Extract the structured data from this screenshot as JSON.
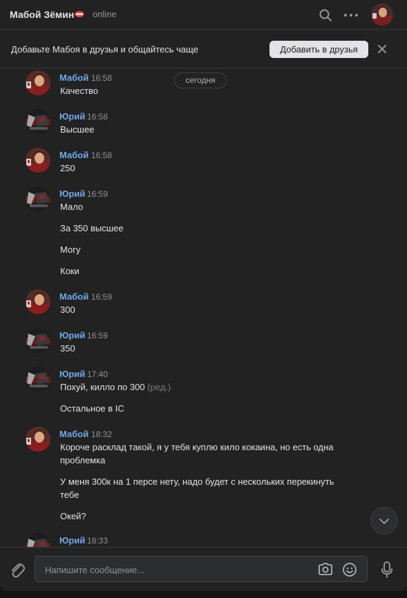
{
  "header": {
    "title": "Мабой Зёмин",
    "status": "online",
    "search_icon": "search-icon",
    "more_icon": "more-horizontal-icon"
  },
  "friend_bar": {
    "text": "Добавьте Мабоя в друзья и общайтесь чаще",
    "button": "Добавить в друзья"
  },
  "date_separator": "сегодня",
  "messages": [
    {
      "author": "Мабой",
      "time": "16:58",
      "lines": [
        "Качество"
      ]
    },
    {
      "author": "Юрий",
      "time": "16:58",
      "lines": [
        "Высшее"
      ]
    },
    {
      "author": "Мабой",
      "time": "16:58",
      "lines": [
        "250"
      ]
    },
    {
      "author": "Юрий",
      "time": "16:59",
      "lines": [
        "Мало",
        "За 350 высшее",
        "Могу",
        "Коки"
      ]
    },
    {
      "author": "Мабой",
      "time": "16:59",
      "lines": [
        "300"
      ]
    },
    {
      "author": "Юрий",
      "time": "16:59",
      "lines": [
        "350"
      ]
    },
    {
      "author": "Юрий",
      "time": "17:40",
      "lines": [
        "Похуй, килло по 300",
        "Остальное в IC"
      ],
      "edited": "(ред.)"
    },
    {
      "author": "Мабой",
      "time": "18:32",
      "lines": [
        "Короче расклад такой, я у тебя куплю кило кокаина, но есть одна проблемка",
        "У меня 300к на 1 персе нету, надо будет с нескольких перекинуть тебе",
        "Окей?"
      ]
    },
    {
      "author": "Юрий",
      "time": "18:33",
      "lines": []
    }
  ],
  "composer": {
    "placeholder": "Напишите сообщение..."
  },
  "colors": {
    "background": "#222222",
    "author": "#71aaeb",
    "text": "#e1e3e6",
    "muted": "#939393"
  }
}
